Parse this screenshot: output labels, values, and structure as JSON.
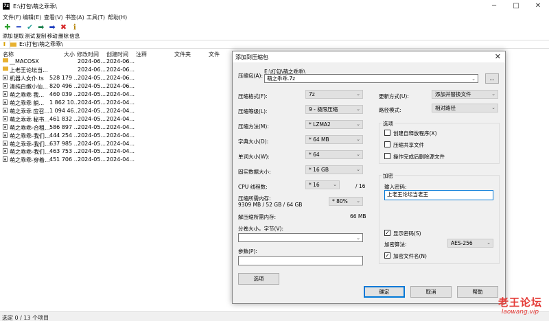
{
  "window": {
    "title": "E:\\打包\\萌之乖乖\\",
    "app_icon": "7z-icon",
    "minimize": "─",
    "maximize": "□",
    "close": "✕"
  },
  "menu": [
    "文件(F)",
    "编辑(E)",
    "查看(V)",
    "书签(A)",
    "工具(T)",
    "帮助(H)"
  ],
  "toolbar": [
    {
      "label": "添加",
      "icon": "✚",
      "color": "#2ca02c"
    },
    {
      "label": "提取",
      "icon": "━",
      "color": "#1f3fbf"
    },
    {
      "label": "测试",
      "icon": "✔",
      "color": "#2aa198"
    },
    {
      "label": "复制",
      "icon": "➡",
      "color": "#1a7f4b"
    },
    {
      "label": "移动",
      "icon": "➡",
      "color": "#1f3fbf"
    },
    {
      "label": "删除",
      "icon": "✖",
      "color": "#d62728"
    },
    {
      "label": "信息",
      "icon": "ℹ",
      "color": "#b8860b"
    }
  ],
  "address": "E:\\打包\\萌之乖乖\\",
  "columns": [
    "名称",
    "大小",
    "修改时间",
    "创建时间",
    "注释",
    "文件夹",
    "文件"
  ],
  "files": [
    {
      "name": "__MACOSX",
      "size": "",
      "modified": "2024-06...",
      "created": "2024-06...",
      "type": "folder"
    },
    {
      "name": "上老王论坛当...",
      "size": "",
      "modified": "2024-06...",
      "created": "2024-06...",
      "type": "folder"
    },
    {
      "name": "机器人女仆.ts",
      "size": "528 179 ...",
      "modified": "2024-05...",
      "created": "2024-06...",
      "type": "file"
    },
    {
      "name": "清纯白嫩小仙...",
      "size": "820 496 ...",
      "modified": "2024-05...",
      "created": "2024-06...",
      "type": "file"
    },
    {
      "name": "萌之乖乖 我...",
      "size": "460 039 ...",
      "modified": "2024-05...",
      "created": "2024-04...",
      "type": "file"
    },
    {
      "name": "萌之乖乖 躺...",
      "size": "1 862 10...",
      "modified": "2024-05...",
      "created": "2024-04...",
      "type": "file"
    },
    {
      "name": "萌之乖乖 应召...",
      "size": "1 094 46...",
      "modified": "2024-05...",
      "created": "2024-04...",
      "type": "file"
    },
    {
      "name": "萌之乖乖 秘书...",
      "size": "461 832 ...",
      "modified": "2024-05...",
      "created": "2024-04...",
      "type": "file"
    },
    {
      "name": "萌之乖乖-合租...",
      "size": "586 897 ...",
      "modified": "2024-05...",
      "created": "2024-04...",
      "type": "file"
    },
    {
      "name": "萌之乖乖-我们...",
      "size": "444 254 ...",
      "modified": "2024-05...",
      "created": "2024-04...",
      "type": "file"
    },
    {
      "name": "萌之乖乖-我们...",
      "size": "637 985 ...",
      "modified": "2024-05...",
      "created": "2024-04...",
      "type": "file"
    },
    {
      "name": "萌之乖乖-我们...",
      "size": "463 753 ...",
      "modified": "2024-05...",
      "created": "2024-04...",
      "type": "file"
    },
    {
      "name": "萌之乖乖-穿着...",
      "size": "451 706 ...",
      "modified": "2024-05...",
      "created": "2024-04...",
      "type": "file"
    }
  ],
  "status": "选定 0 / 13 个项目",
  "dialog": {
    "title": "添加到压缩包",
    "close": "✕",
    "archive_label": "压缩包(A):",
    "archive_path": "E:\\打包\\萌之乖乖\\",
    "archive_name": "萌之乖乖.7z",
    "browse": "...",
    "format_label": "压缩格式(F):",
    "format_value": "7z",
    "level_label": "压缩等级(L):",
    "level_value": "9 - 极限压缩",
    "method_label": "压缩方法(M):",
    "method_value": "* LZMA2",
    "dict_label": "字典大小(D):",
    "dict_value": "* 64 MB",
    "word_label": "单词大小(W):",
    "word_value": "* 64",
    "solid_label": "固实数据大小:",
    "solid_value": "* 16 GB",
    "threads_label": "CPU 线程数:",
    "threads_value": "* 16",
    "threads_total": "/ 16",
    "mem_comp_label": "压缩所需内存:",
    "mem_comp_detail": "9309 MB / 52 GB / 64 GB",
    "mem_comp_value": "* 80%",
    "mem_decomp_label": "解压缩所需内存:",
    "mem_decomp_value": "66 MB",
    "split_label": "分卷大小，字节(V):",
    "split_value": "",
    "params_label": "参数(P):",
    "params_value": "",
    "options_button": "选项",
    "update_label": "更新方式(U):",
    "update_value": "添加并替换文件",
    "path_label": "路径模式:",
    "path_value": "相对路径",
    "options_group": "选项",
    "opt_sfx": "创建自释放程序(X)",
    "opt_shared": "压缩共享文件",
    "opt_delete": "操作完成后删除源文件",
    "enc_group": "加密",
    "password_label": "输入密码:",
    "password_value": "上老王论坛当老王",
    "show_password": "显示密码(S)",
    "enc_method_label": "加密算法:",
    "enc_method_value": "AES-256",
    "enc_names": "加密文件名(N)",
    "ok": "确定",
    "cancel": "取消",
    "help": "帮助"
  },
  "watermark": {
    "title": "老王论坛",
    "sub": "laowang.vip"
  }
}
